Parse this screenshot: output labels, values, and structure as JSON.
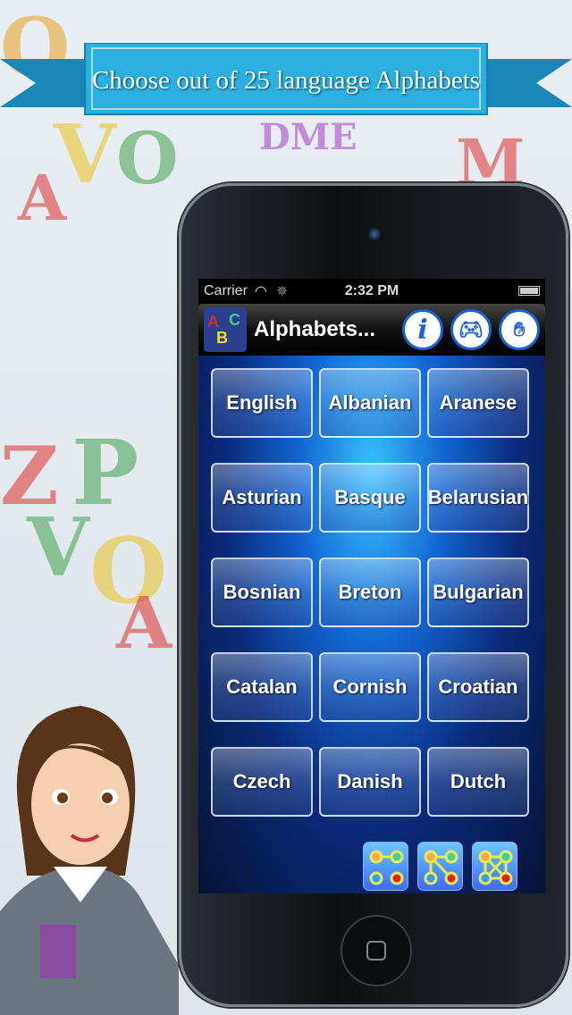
{
  "banner": {
    "text": "Choose out of 25 language Alphabets"
  },
  "status_bar": {
    "carrier": "Carrier",
    "time": "2:32 PM"
  },
  "nav": {
    "title": "Alphabets...",
    "logo_letters": [
      "A",
      "B",
      "C"
    ],
    "buttons": [
      {
        "icon": "info-icon"
      },
      {
        "icon": "gamepad-icon"
      },
      {
        "icon": "hand-plant-icon"
      }
    ]
  },
  "languages": [
    "English",
    "Albanian",
    "Aranese",
    "Asturian",
    "Basque",
    "Belarusian",
    "Bosnian",
    "Breton",
    "Bulgarian",
    "Catalan",
    "Cornish",
    "Croatian",
    "Czech",
    "Danish",
    "Dutch"
  ],
  "toolbar": [
    {
      "icon": "connect-dots-1-icon"
    },
    {
      "icon": "connect-dots-2-icon"
    },
    {
      "icon": "connect-dots-3-icon"
    }
  ],
  "colors": {
    "accent": "#1a5fd6",
    "ribbon": "#2bb0e0"
  }
}
